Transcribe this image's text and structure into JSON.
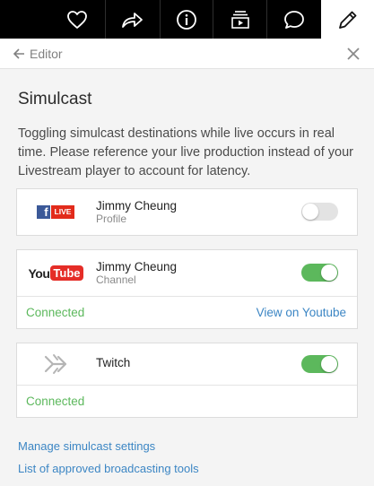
{
  "toolbar": {
    "icons": [
      "heart-icon",
      "share-icon",
      "info-icon",
      "playlist-icon",
      "chat-icon",
      "pencil-icon"
    ],
    "active": "pencil-icon"
  },
  "editor": {
    "back_label": "Editor"
  },
  "page": {
    "title": "Simulcast",
    "description": "Toggling simulcast destinations while live occurs in real time. Please reference your live production instead of your Livestream player to account for latency."
  },
  "destinations": [
    {
      "platform_logo": "LIVE",
      "name": "Jimmy Cheung",
      "type": "Profile",
      "enabled": false
    },
    {
      "platform_logo": "YouTube",
      "name": "Jimmy Cheung",
      "type": "Channel",
      "enabled": true,
      "status": "Connected",
      "link_label": "View on Youtube"
    },
    {
      "platform_logo": "twitch-icon",
      "name": "Twitch",
      "enabled": true,
      "status": "Connected"
    }
  ],
  "links": {
    "manage": "Manage simulcast settings",
    "tools": "List of approved broadcasting tools"
  },
  "colors": {
    "accent_link": "#3c86c4",
    "connected_green": "#5cb85c",
    "facebook_blue": "#3b5998",
    "live_red": "#e22b1b",
    "youtube_red": "#e52d27"
  }
}
